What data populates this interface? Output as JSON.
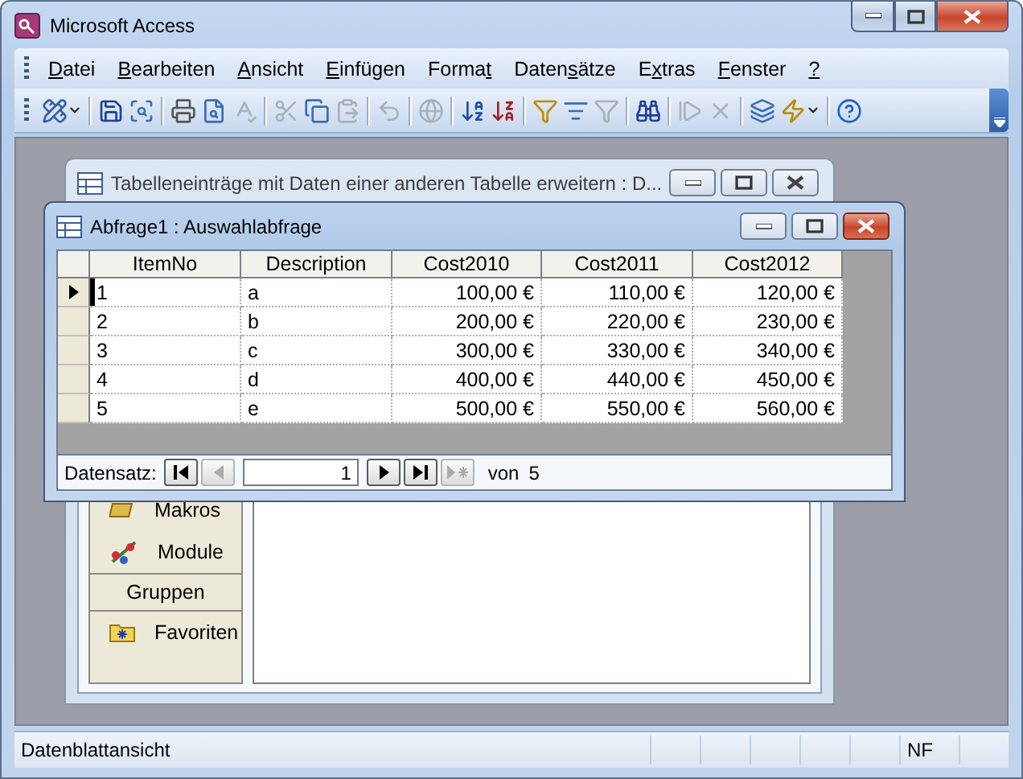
{
  "window": {
    "title": "Microsoft Access"
  },
  "menu": [
    {
      "key": "D",
      "after": "atei"
    },
    {
      "key": "B",
      "after": "earbeiten"
    },
    {
      "key": "A",
      "after": "nsicht"
    },
    {
      "key": "E",
      "after": "infügen"
    },
    {
      "before": "Forma",
      "key": "t"
    },
    {
      "before": "Daten",
      "key": "s",
      "after": "ätze"
    },
    {
      "before": "E",
      "key": "x",
      "after": "tras"
    },
    {
      "key": "F",
      "after": "enster"
    },
    {
      "key": "?"
    }
  ],
  "toolbar": [
    {
      "kind": "design",
      "disabled": false,
      "dropdown": true
    },
    {
      "kind": "sep"
    },
    {
      "kind": "save",
      "disabled": false,
      "dropdown": false
    },
    {
      "kind": "search",
      "disabled": false,
      "dropdown": false
    },
    {
      "kind": "sep"
    },
    {
      "kind": "print",
      "disabled": false,
      "dropdown": false
    },
    {
      "kind": "preview",
      "disabled": false,
      "dropdown": false
    },
    {
      "kind": "spell",
      "disabled": true,
      "dropdown": false
    },
    {
      "kind": "sep"
    },
    {
      "kind": "cut",
      "disabled": true,
      "dropdown": false
    },
    {
      "kind": "copy",
      "disabled": false,
      "dropdown": false
    },
    {
      "kind": "paste",
      "disabled": true,
      "dropdown": false
    },
    {
      "kind": "sep"
    },
    {
      "kind": "undo",
      "disabled": true,
      "dropdown": false
    },
    {
      "kind": "sep"
    },
    {
      "kind": "globe",
      "disabled": true,
      "dropdown": false
    },
    {
      "kind": "sep"
    },
    {
      "kind": "sortaz",
      "disabled": false,
      "dropdown": false
    },
    {
      "kind": "sortza",
      "disabled": false,
      "dropdown": false
    },
    {
      "kind": "sep"
    },
    {
      "kind": "filtersel",
      "disabled": false,
      "dropdown": false
    },
    {
      "kind": "filterform",
      "disabled": false,
      "dropdown": false
    },
    {
      "kind": "filter",
      "disabled": true,
      "dropdown": false
    },
    {
      "kind": "sep"
    },
    {
      "kind": "find",
      "disabled": false,
      "dropdown": false
    },
    {
      "kind": "sep"
    },
    {
      "kind": "newrec",
      "disabled": true,
      "dropdown": false
    },
    {
      "kind": "delrec",
      "disabled": true,
      "dropdown": false
    },
    {
      "kind": "sep"
    },
    {
      "kind": "dbwin",
      "disabled": false,
      "dropdown": false
    },
    {
      "kind": "newobj",
      "disabled": false,
      "dropdown": true
    },
    {
      "kind": "sep"
    },
    {
      "kind": "help",
      "disabled": false,
      "dropdown": false
    }
  ],
  "db_window": {
    "title": "Tabelleneinträge mit Daten einer anderen Tabelle erweitern : D...",
    "active": false,
    "sidebar": [
      {
        "kind": "macros",
        "label": "Makros"
      },
      {
        "kind": "modules",
        "label": "Module"
      },
      {
        "kind": "header",
        "label": "Gruppen"
      },
      {
        "kind": "favorites",
        "label": "Favoriten"
      }
    ]
  },
  "query_window": {
    "title": "Abfrage1 : Auswahlabfrage",
    "active": true,
    "columns": [
      "ItemNo",
      "Description",
      "Cost2010",
      "Cost2011",
      "Cost2012"
    ],
    "rows": [
      {
        "selected": true,
        "cells": [
          "1",
          "a",
          "100,00 €",
          "110,00 €",
          "120,00 €"
        ]
      },
      {
        "selected": false,
        "cells": [
          "2",
          "b",
          "200,00 €",
          "220,00 €",
          "230,00 €"
        ]
      },
      {
        "selected": false,
        "cells": [
          "3",
          "c",
          "300,00 €",
          "330,00 €",
          "340,00 €"
        ]
      },
      {
        "selected": false,
        "cells": [
          "4",
          "d",
          "400,00 €",
          "440,00 €",
          "450,00 €"
        ]
      },
      {
        "selected": false,
        "cells": [
          "5",
          "e",
          "500,00 €",
          "550,00 €",
          "560,00 €"
        ]
      }
    ],
    "navigation": {
      "label": "Datensatz:",
      "record": "1",
      "of_label": "von",
      "total": "5",
      "buttons_before": [
        {
          "kind": "first",
          "disabled": false
        },
        {
          "kind": "prev",
          "disabled": true
        }
      ],
      "buttons_after": [
        {
          "kind": "next",
          "disabled": false
        },
        {
          "kind": "last",
          "disabled": false
        },
        {
          "kind": "new",
          "disabled": true
        }
      ]
    }
  },
  "status_bar": {
    "text": "Datenblattansicht",
    "indicators": [
      "NF"
    ]
  }
}
